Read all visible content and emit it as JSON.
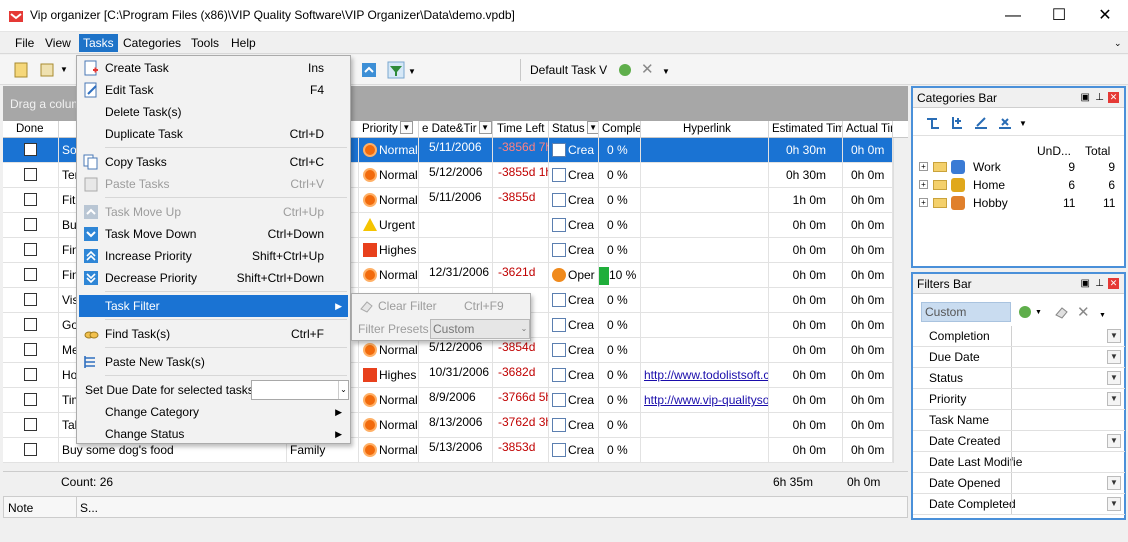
{
  "window": {
    "title": "Vip organizer [C:\\Program Files (x86)\\VIP Quality Software\\VIP Organizer\\Data\\demo.vpdb]",
    "minimize": "—",
    "maximize": "☐",
    "close": "✕"
  },
  "menu": {
    "file": "File",
    "view": "View",
    "tasks": "Tasks",
    "categories": "Categories",
    "tools": "Tools",
    "help": "Help"
  },
  "toolbar": {
    "view_select": "Default Task V"
  },
  "grid": {
    "group_hint": "Drag a column",
    "headers": {
      "done": "Done",
      "priority": "Priority",
      "due": "e Date&Tir",
      "timeleft": "Time Left",
      "status": "Status",
      "complete": "Complete",
      "hyperlink": "Hyperlink",
      "estimated": "Estimated Time",
      "actual": "Actual Tin"
    },
    "rows": [
      {
        "name": "Sof",
        "priority": "Normal",
        "pri": "normal",
        "due": "5/11/2006",
        "left": "-3856d 7h",
        "status": "Crea",
        "complete": "0 %",
        "link": "",
        "est": "0h 30m",
        "act": "0h 0m"
      },
      {
        "name": "Ten",
        "priority": "Normal",
        "pri": "normal",
        "due": "5/12/2006",
        "left": "-3855d 1h",
        "status": "Crea",
        "complete": "0 %",
        "link": "",
        "est": "0h 30m",
        "act": "0h 0m"
      },
      {
        "name": "Fitn",
        "priority": "Normal",
        "pri": "normal",
        "due": "5/11/2006",
        "left": "-3855d",
        "status": "Crea",
        "complete": "0 %",
        "link": "",
        "est": "1h 0m",
        "act": "0h 0m"
      },
      {
        "name": "Buy",
        "priority": "Urgent",
        "pri": "urgent",
        "due": "",
        "left": "",
        "status": "Crea",
        "complete": "0 %",
        "link": "",
        "est": "0h 0m",
        "act": "0h 0m"
      },
      {
        "name": "Find",
        "priority": "Highes",
        "pri": "high",
        "due": "",
        "left": "",
        "status": "Crea",
        "complete": "0 %",
        "link": "",
        "est": "0h 0m",
        "act": "0h 0m"
      },
      {
        "name": "Finis",
        "priority": "Normal",
        "pri": "normal",
        "due": "12/31/2006",
        "left": "-3621d",
        "status": "Oper",
        "complete": "10 %",
        "link": "",
        "est": "0h 0m",
        "act": "0h 0m"
      },
      {
        "name": "Visit",
        "priority": "Normal",
        "pri": "normal",
        "due": "",
        "left": "",
        "status": "Crea",
        "complete": "0 %",
        "link": "",
        "est": "0h 0m",
        "act": "0h 0m"
      },
      {
        "name": "Go",
        "priority": "Normal",
        "pri": "normal",
        "due": "",
        "left": "",
        "status": "Crea",
        "complete": "0 %",
        "link": "",
        "est": "0h 0m",
        "act": "0h 0m"
      },
      {
        "name": "Mee",
        "priority": "Normal",
        "pri": "normal",
        "due": "5/12/2006",
        "left": "-3854d",
        "status": "Crea",
        "complete": "0 %",
        "link": "",
        "est": "0h 0m",
        "act": "0h 0m"
      },
      {
        "name": "How",
        "priority": "Highes",
        "pri": "high",
        "due": "10/31/2006",
        "left": "-3682d",
        "status": "Crea",
        "complete": "0 %",
        "link": "http://www.todolistsoft.co",
        "est": "0h 0m",
        "act": "0h 0m"
      },
      {
        "name": "Time",
        "priority": "Normal",
        "pri": "normal",
        "due": "8/9/2006",
        "left": "-3766d 5h",
        "status": "Crea",
        "complete": "0 %",
        "link": "http://www.vip-qualitysof",
        "est": "0h 0m",
        "act": "0h 0m"
      },
      {
        "name": "Tak",
        "priority": "Normal",
        "pri": "normal",
        "due": "8/13/2006",
        "left": "-3762d 3h",
        "status": "Crea",
        "complete": "0 %",
        "link": "",
        "est": "0h 0m",
        "act": "0h 0m"
      },
      {
        "name": "Buy some dog's food",
        "category": "Family",
        "priority": "Normal",
        "pri": "normal",
        "due": "5/13/2006",
        "left": "-3853d",
        "status": "Crea",
        "complete": "0 %",
        "link": "",
        "est": "0h 0m",
        "act": "0h 0m"
      }
    ],
    "footer": {
      "count": "Count: 26",
      "est_total": "6h 35m",
      "act_total": "0h 0m"
    }
  },
  "notebar": {
    "note": "Note",
    "s": "S..."
  },
  "categories": {
    "title": "Categories Bar",
    "col_undone": "UnD...",
    "col_total": "Total",
    "items": [
      {
        "name": "Work",
        "undone": "9",
        "total": "9"
      },
      {
        "name": "Home",
        "undone": "6",
        "total": "6"
      },
      {
        "name": "Hobby",
        "undone": "11",
        "total": "11"
      }
    ]
  },
  "filters": {
    "title": "Filters Bar",
    "preset": "Custom",
    "items": [
      "Completion",
      "Due Date",
      "Status",
      "Priority",
      "Task Name",
      "Date Created",
      "Date Last Modifie",
      "Date Opened",
      "Date Completed"
    ]
  },
  "tasks_menu": {
    "create": "Create Task",
    "create_sc": "Ins",
    "edit": "Edit Task",
    "edit_sc": "F4",
    "delete": "Delete Task(s)",
    "duplicate": "Duplicate Task",
    "duplicate_sc": "Ctrl+D",
    "copy": "Copy Tasks",
    "copy_sc": "Ctrl+C",
    "paste": "Paste Tasks",
    "paste_sc": "Ctrl+V",
    "moveup": "Task Move Up",
    "moveup_sc": "Ctrl+Up",
    "movedown": "Task Move Down",
    "movedown_sc": "Ctrl+Down",
    "incpri": "Increase Priority",
    "incpri_sc": "Shift+Ctrl+Up",
    "decpri": "Decrease Priority",
    "decpri_sc": "Shift+Ctrl+Down",
    "filter": "Task Filter",
    "find": "Find Task(s)",
    "find_sc": "Ctrl+F",
    "pastenew": "Paste New Task(s)",
    "setdue": "Set Due Date for selected tasks",
    "changecat": "Change Category",
    "changestatus": "Change Status"
  },
  "filter_submenu": {
    "clear": "Clear Filter",
    "clear_sc": "Ctrl+F9",
    "presets": "Filter Presets",
    "presets_value": "Custom"
  }
}
